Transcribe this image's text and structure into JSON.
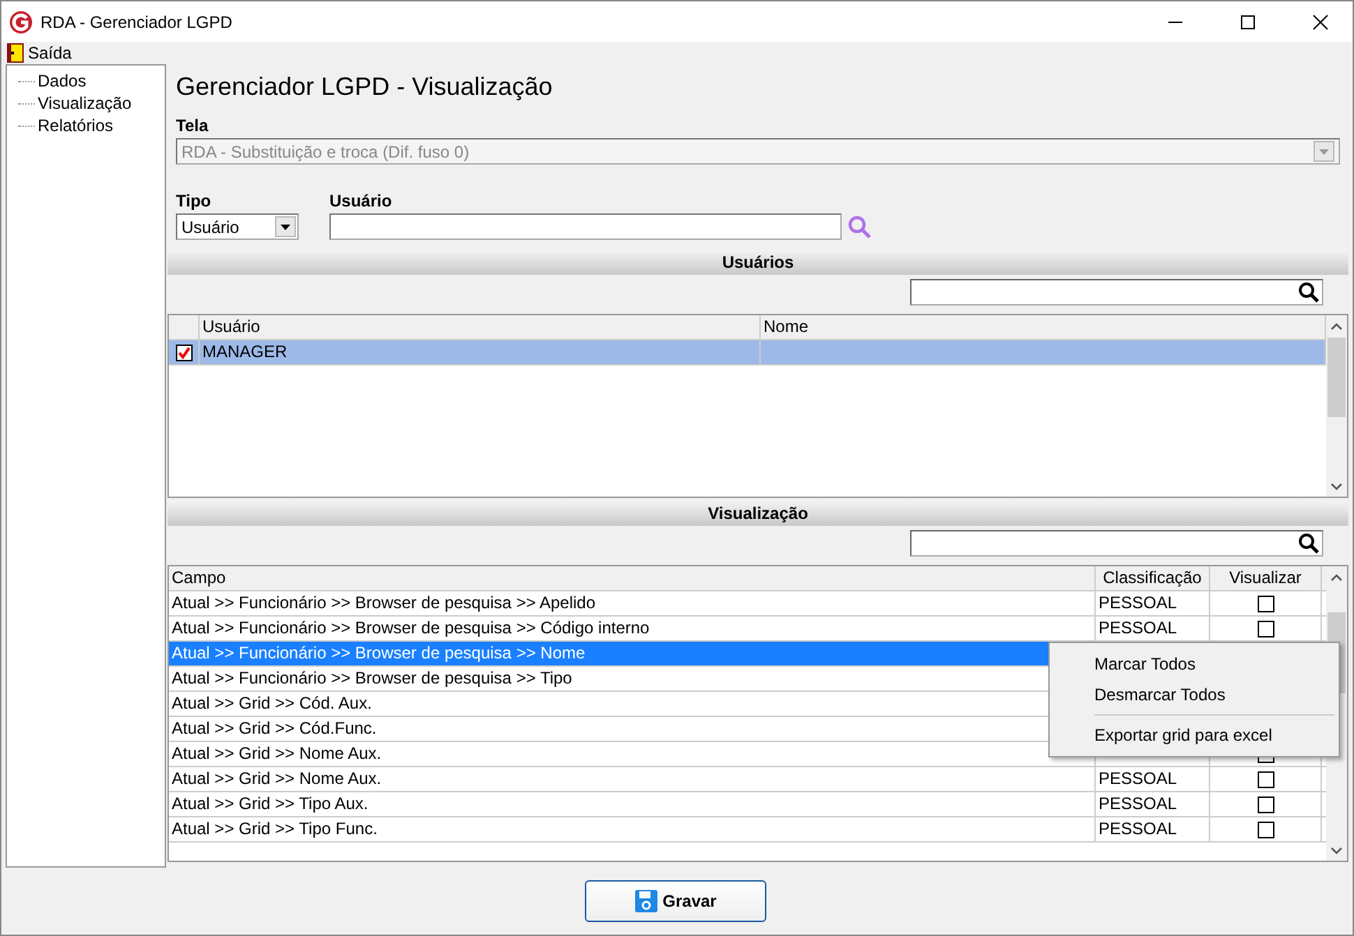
{
  "window": {
    "title": "RDA - Gerenciador LGPD"
  },
  "menu": [
    {
      "label": "Saída"
    }
  ],
  "tree": {
    "items": [
      {
        "label": "Dados"
      },
      {
        "label": "Visualização"
      },
      {
        "label": "Relatórios"
      }
    ]
  },
  "page_title": "Gerenciador LGPD - Visualização",
  "tela": {
    "label": "Tela",
    "value": "RDA - Substituição e troca (Dif. fuso 0)",
    "disabled": true
  },
  "tipo": {
    "label": "Tipo",
    "value": "Usuário"
  },
  "usuario": {
    "label": "Usuário"
  },
  "users": {
    "header": "Usuários",
    "columns": [
      "Usuário",
      "Nome"
    ],
    "rows": [
      {
        "checked": true,
        "selected": true,
        "usuario": "MANAGER"
      }
    ]
  },
  "visualizacao": {
    "header": "Visualização",
    "columns": [
      "Campo",
      "Classificação",
      "Visualizar"
    ],
    "rows": [
      {
        "campo": "Atual >> Funcionário >> Browser de pesquisa >> Apelido",
        "classificacao": "PESSOAL",
        "checked": false,
        "selected": false
      },
      {
        "campo": "Atual >> Funcionário >> Browser de pesquisa >> Código interno",
        "classificacao": "PESSOAL",
        "checked": false,
        "selected": false
      },
      {
        "campo": "Atual >> Funcionário >> Browser de pesquisa >> Nome",
        "selected": true
      },
      {
        "campo": "Atual >> Funcionário >> Browser de pesquisa >> Tipo",
        "selected": false
      },
      {
        "campo": "Atual >> Grid >> Cód. Aux.",
        "selected": false
      },
      {
        "campo": "Atual >> Grid >> Cód.Func.",
        "selected": false
      },
      {
        "campo": "Atual >> Grid >> Nome Aux.",
        "checked": false,
        "selected": false
      },
      {
        "campo": "Atual >> Grid >> Nome Aux.",
        "classificacao": "PESSOAL",
        "checked": false,
        "selected": false
      },
      {
        "campo": "Atual >> Grid >> Tipo Aux.",
        "classificacao": "PESSOAL",
        "checked": false,
        "selected": false
      },
      {
        "campo": "Atual >> Grid >> Tipo Func.",
        "classificacao": "PESSOAL",
        "checked": false,
        "selected": false
      }
    ]
  },
  "context_menu": [
    {
      "kind": "item",
      "label": "Marcar Todos"
    },
    {
      "kind": "item",
      "label": "Desmarcar Todos"
    },
    {
      "kind": "separator"
    },
    {
      "kind": "item",
      "label": "Exportar grid para excel"
    }
  ],
  "save_button": {
    "label": "Gravar"
  }
}
